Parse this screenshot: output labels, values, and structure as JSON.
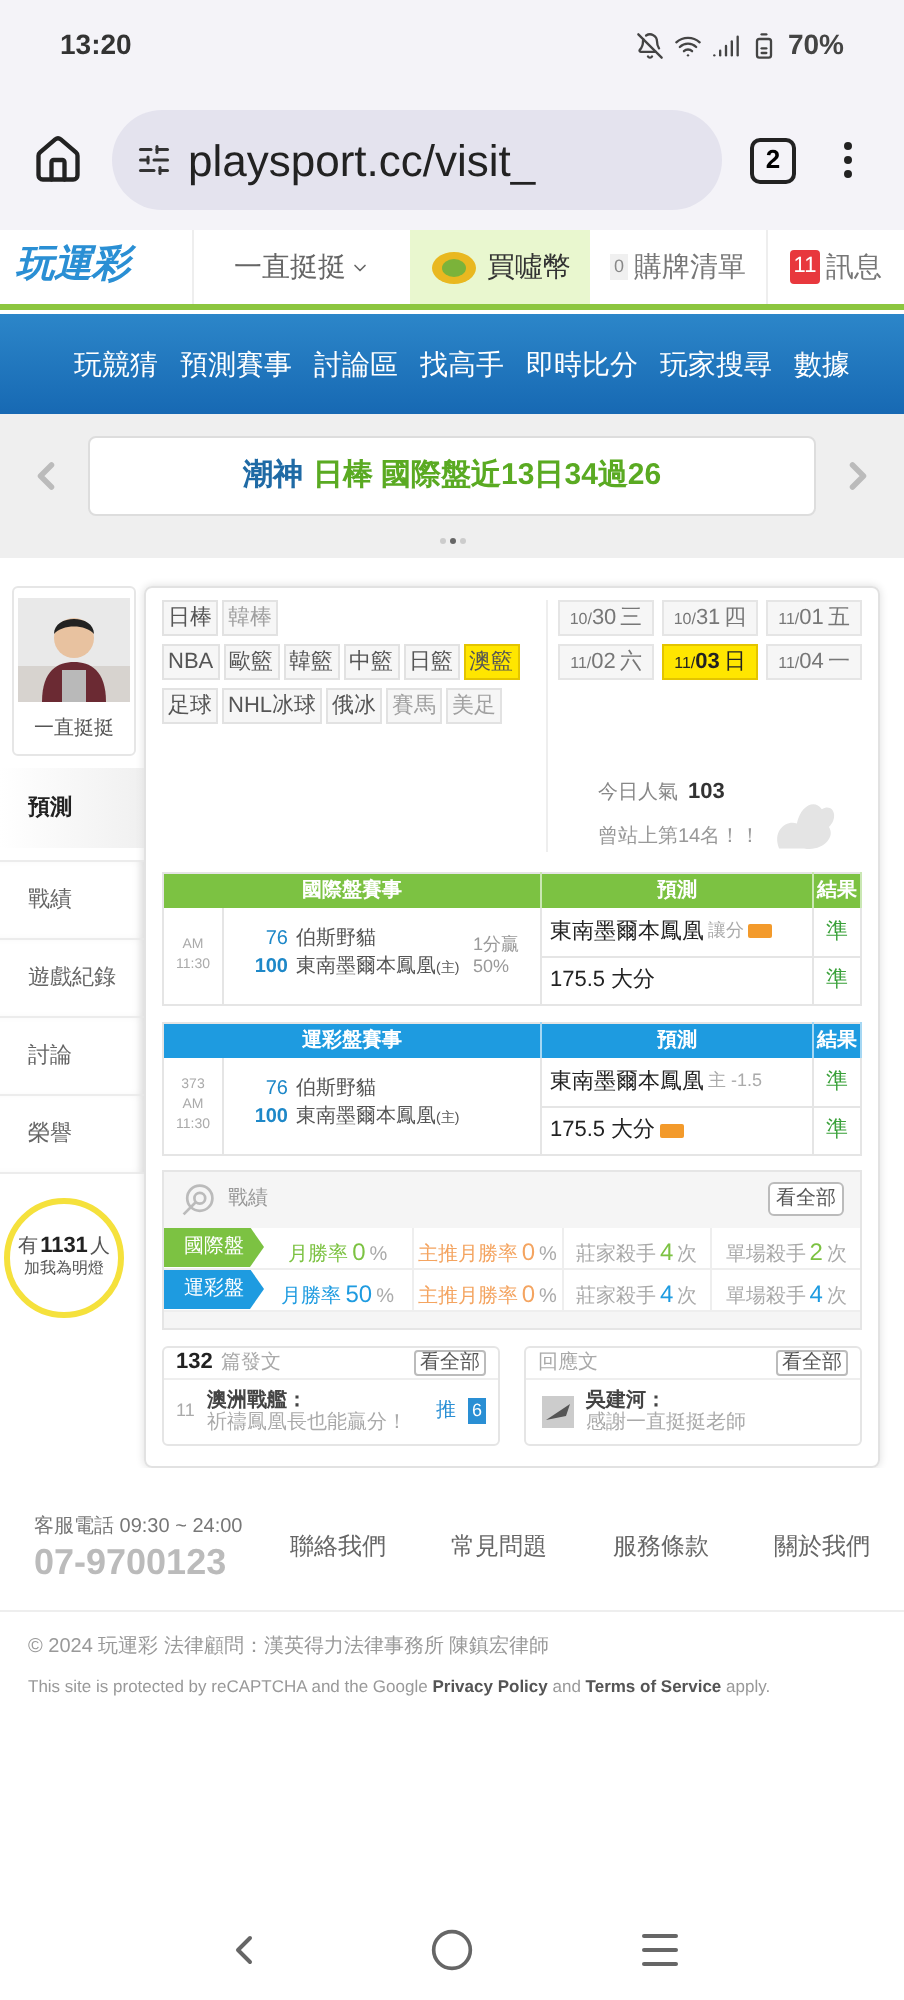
{
  "status_bar": {
    "time": "13:20",
    "battery": "70%"
  },
  "browser": {
    "url": "playsport.cc/visit_",
    "tab_count": "2"
  },
  "site_header": {
    "logo": "玩運彩",
    "user_menu": "一直挺挺",
    "buy_coins": "買噓幣",
    "cart_count": "0",
    "cart": "購牌清單",
    "message_count": "11",
    "messages": "訊息"
  },
  "main_nav": [
    "玩競猜",
    "預測賽事",
    "討論區",
    "找高手",
    "即時比分",
    "玩家搜尋",
    "數據"
  ],
  "carousel": {
    "expert": "潮神",
    "text": "日棒 國際盤近13日34過26",
    "dots": [
      {
        "selected": false
      },
      {
        "selected": true
      },
      {
        "selected": false
      }
    ]
  },
  "profile": {
    "name": "一直挺挺"
  },
  "side_menu": [
    {
      "label": "預測",
      "selected": true
    },
    {
      "label": "戰績",
      "selected": false
    },
    {
      "label": "遊戲紀錄",
      "selected": false
    },
    {
      "label": "討論",
      "selected": false
    },
    {
      "label": "榮譽",
      "selected": false
    }
  ],
  "fans": {
    "prefix": "有",
    "count": "1131",
    "suffix": "人",
    "caption": "加我為明燈"
  },
  "sport_tags": [
    [
      {
        "label": "日棒",
        "selected": false,
        "disabled": false
      },
      {
        "label": "韓棒",
        "selected": false,
        "disabled": true
      }
    ],
    [
      {
        "label": "NBA",
        "selected": false,
        "disabled": false
      },
      {
        "label": "歐籃",
        "selected": false,
        "disabled": false
      },
      {
        "label": "韓籃",
        "selected": false,
        "disabled": false
      },
      {
        "label": "中籃",
        "selected": false,
        "disabled": false
      },
      {
        "label": "日籃",
        "selected": false,
        "disabled": false
      },
      {
        "label": "澳籃",
        "selected": true,
        "disabled": false
      }
    ],
    [
      {
        "label": "足球",
        "selected": false,
        "disabled": false
      },
      {
        "label": "NHL冰球",
        "selected": false,
        "disabled": false
      },
      {
        "label": "俄冰",
        "selected": false,
        "disabled": false
      },
      {
        "label": "賽馬",
        "selected": false,
        "disabled": true
      },
      {
        "label": "美足",
        "selected": false,
        "disabled": true
      }
    ]
  ],
  "dates": [
    {
      "month": "10/",
      "day": "30",
      "weekday": "三",
      "selected": false
    },
    {
      "month": "10/",
      "day": "31",
      "weekday": "四",
      "selected": false
    },
    {
      "month": "11/",
      "day": "01",
      "weekday": "五",
      "selected": false
    },
    {
      "month": "11/",
      "day": "02",
      "weekday": "六",
      "selected": false
    },
    {
      "month": "11/",
      "day": "03",
      "weekday": "日",
      "selected": true
    },
    {
      "month": "11/",
      "day": "04",
      "weekday": "一",
      "selected": false
    }
  ],
  "popularity": {
    "label": "今日人氣",
    "value": "103",
    "rank": "曾站上第14名！！"
  },
  "tables": [
    {
      "color": "#7cc242",
      "columns": [
        "國際盤賽事",
        "預測",
        "結果"
      ],
      "meta": [
        "AM 11:30"
      ],
      "teams": [
        {
          "score": "76",
          "name": "伯斯野貓"
        },
        {
          "score": "100",
          "name": "東南墨爾本鳳凰",
          "tag": "(主)"
        }
      ],
      "note": [
        "1分贏",
        "50%"
      ],
      "picks": [
        {
          "text": "東南墨爾本鳳凰",
          "detail": "讓分",
          "badge": true,
          "result": "準"
        },
        {
          "text": "175.5 大分",
          "badge": false,
          "result": "準"
        }
      ]
    },
    {
      "color": "#1e9be0",
      "columns": [
        "運彩盤賽事",
        "預測",
        "結果"
      ],
      "meta": [
        "373",
        "AM 11:30"
      ],
      "teams": [
        {
          "score": "76",
          "name": "伯斯野貓"
        },
        {
          "score": "100",
          "name": "東南墨爾本鳳凰",
          "tag": "(主)"
        }
      ],
      "picks": [
        {
          "text": "東南墨爾本鳳凰",
          "detail": "主 -1.5",
          "badge": false,
          "result": "準"
        },
        {
          "text": "175.5 大分",
          "badge": true,
          "result": "準"
        }
      ]
    }
  ],
  "record": {
    "title": "戰績",
    "view_all": "看全部",
    "rows": [
      {
        "label": "國際盤",
        "color": "#7cc242",
        "stats": [
          {
            "label": "月勝率",
            "value": "0",
            "unit": "%"
          },
          {
            "label": "主推月勝率",
            "value": "0",
            "unit": "%"
          },
          {
            "label": "莊家殺手",
            "value": "4",
            "unit": "次"
          },
          {
            "label": "單場殺手",
            "value": "2",
            "unit": "次"
          }
        ]
      },
      {
        "label": "運彩盤",
        "color": "#1e9be0",
        "stats": [
          {
            "label": "月勝率",
            "value": "50",
            "unit": "%"
          },
          {
            "label": "主推月勝率",
            "value": "0",
            "unit": "%"
          },
          {
            "label": "莊家殺手",
            "value": "4",
            "unit": "次"
          },
          {
            "label": "單場殺手",
            "value": "4",
            "unit": "次"
          }
        ]
      }
    ]
  },
  "posts": {
    "count": "132",
    "label": "篇發文",
    "view_all": "看全部",
    "item": {
      "number": "11",
      "author": "澳洲戰艦：",
      "text": "祈禱鳳凰長也能贏分！",
      "push_label": "推",
      "push_count": "6"
    }
  },
  "replies": {
    "label": "回應文",
    "view_all": "看全部",
    "item": {
      "author": "吳建河：",
      "text": "感謝一直挺挺老師"
    }
  },
  "footer": {
    "hours": "客服電話 09:30 ~ 24:00",
    "phone": "07-9700123",
    "links": [
      "聯絡我們",
      "常見問題",
      "服務條款",
      "關於我們"
    ]
  },
  "legal": {
    "copyright": "© 2024 玩運彩 法律顧問：漢英得力法律事務所 陳鎮宏律師",
    "recaptcha": "This site is protected by reCAPTCHA and the Google **Privacy Policy** and **Terms of Service** apply."
  }
}
